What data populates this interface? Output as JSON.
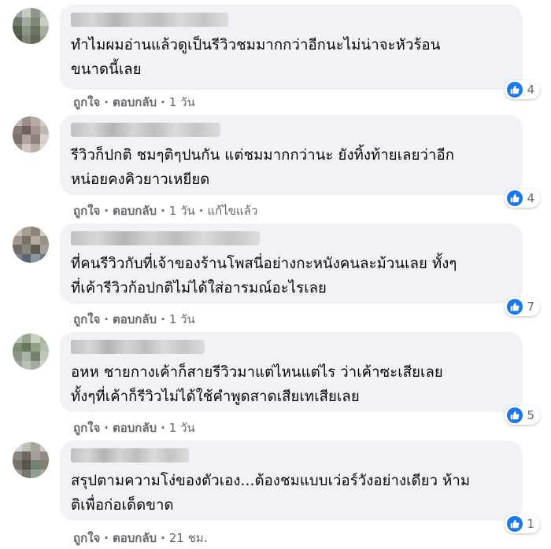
{
  "colors": {
    "bubble": "#f0f2f5",
    "meta_text": "#65676b",
    "like_blue": "#1877f2"
  },
  "icons": {
    "reaction": "like-thumbs-up-icon"
  },
  "comments": [
    {
      "text": "ทำไมผมอ่านแล้วดูเป็นรีวิวชมมากกว่าอีกนะไม่น่าจะหัวร้อน\nขนาดนี้เลย",
      "like": "ถูกใจ",
      "reply": "ตอบกลับ",
      "time": "1 วัน",
      "edited": "",
      "reactions": "4"
    },
    {
      "text": "รีวิวก็ปกติ ชมๆติๆปนกัน แต่ชมมากกว่านะ ยังทิ้งท้ายเลยว่าอีก\nหน่อยคงคิวยาวเหยียด",
      "like": "ถูกใจ",
      "reply": "ตอบกลับ",
      "time": "1 วัน",
      "edited": "แก้ไขแล้ว",
      "reactions": "4"
    },
    {
      "text": "ที่คนรีวิวกับที่เจ้าของร้านโพสนี่อย่างกะหนังคนละม้วนเลย ทั้งๆ\nที่เค้ารีวิวก้อปกติไม่ได้ใส่อารมณ์อะไรเลย",
      "like": "ถูกใจ",
      "reply": "ตอบกลับ",
      "time": "1 วัน",
      "edited": "",
      "reactions": "7"
    },
    {
      "text": "อหห ชายกางเค้าก็สายรีวิวมาแต่ไหนแต่ไร ว่าเค้าซะเสียเลย\nทั้งๆที่เค้าก็รีวิวไม่ได้ใช้คำพูดสาดเสียเทเสียเลย",
      "like": "ถูกใจ",
      "reply": "ตอบกลับ",
      "time": "1 วัน",
      "edited": "",
      "reactions": "5"
    },
    {
      "text": "สรุปตามความโง่ของตัวเอง...ต้องชมแบบเว่อร์วังอย่างเดียว ห้าม\nติเพื่อก่อเด็ดขาด",
      "like": "ถูกใจ",
      "reply": "ตอบกลับ",
      "time": "21 ชม.",
      "edited": "",
      "reactions": "1"
    }
  ]
}
